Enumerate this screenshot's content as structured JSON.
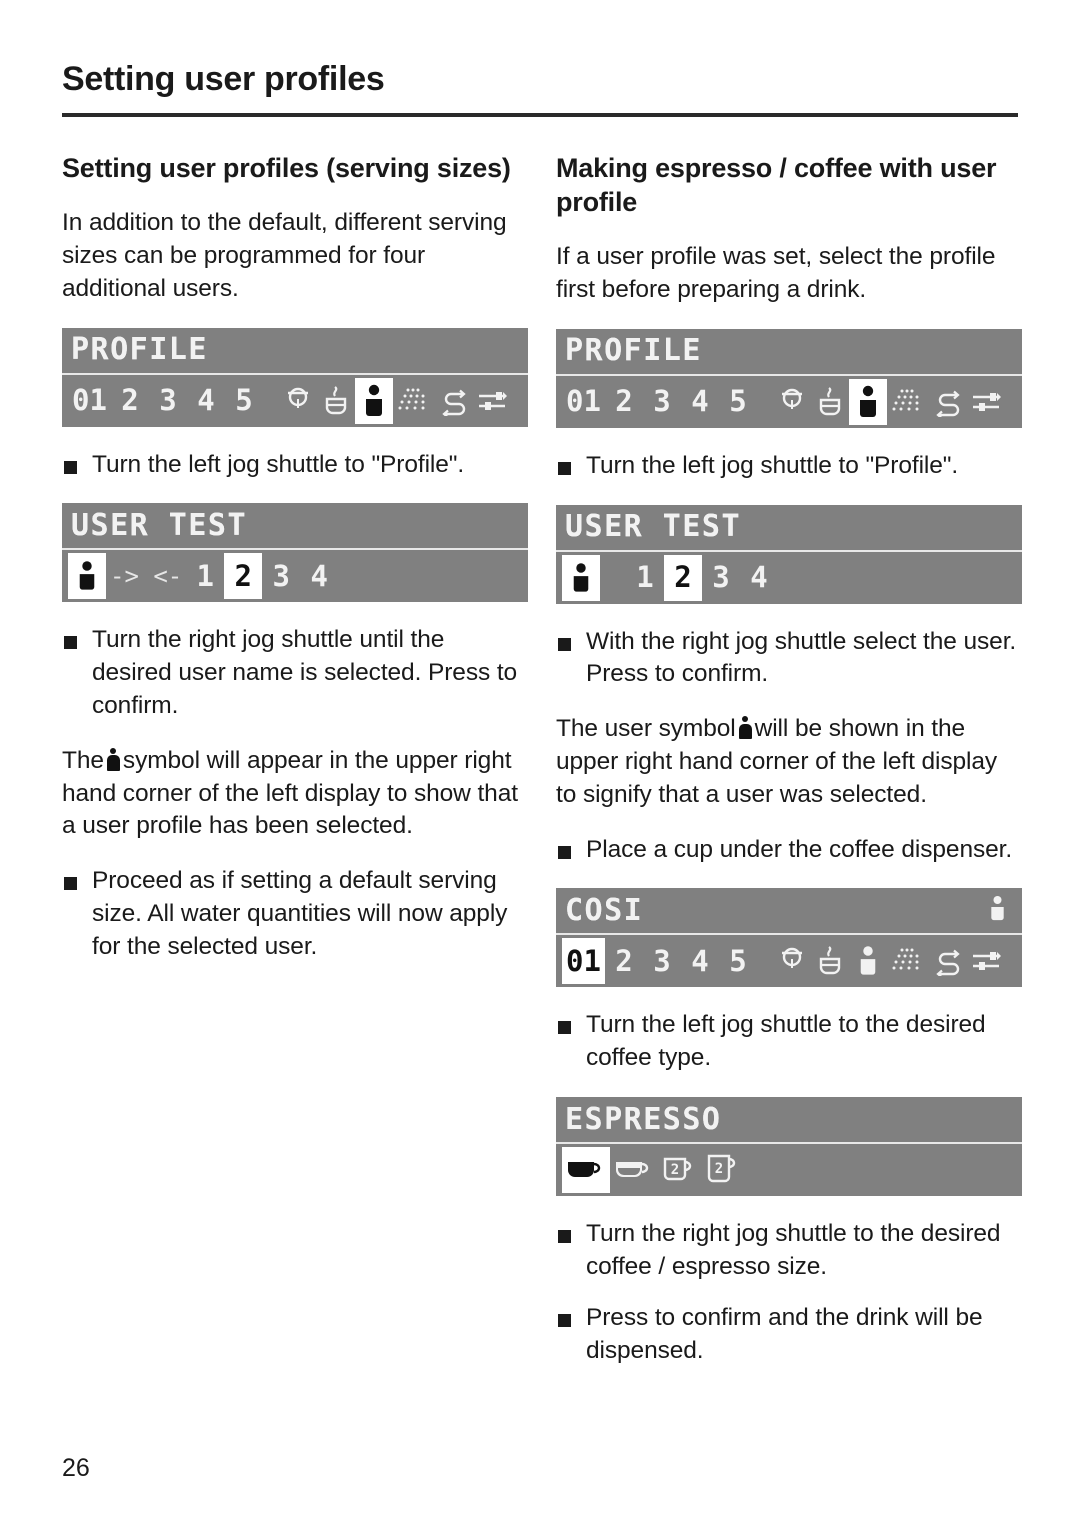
{
  "running_head": "Setting user profiles",
  "folio": "26",
  "colors": {
    "lcd_background": "#808080",
    "lcd_foreground": "#f2f2f2",
    "lcd_selected_background": "#ffffff",
    "lcd_selected_foreground": "#111111",
    "text": "#1a1a1a"
  },
  "left_column": {
    "title": "Setting user profiles (serving sizes)",
    "intro": "In addition to the default, different serving sizes can be programmed for four additional users.",
    "display_profile": {
      "title": "PROFILE",
      "items": [
        {
          "label": "01",
          "type": "number",
          "selected": false
        },
        {
          "label": "2",
          "type": "number",
          "selected": false
        },
        {
          "label": "3",
          "type": "number",
          "selected": false
        },
        {
          "label": "4",
          "type": "number",
          "selected": false
        },
        {
          "label": "5",
          "type": "number",
          "selected": false
        },
        {
          "label": "timer-icon",
          "type": "icon",
          "selected": false
        },
        {
          "label": "hot-cup-icon",
          "type": "icon",
          "selected": false
        },
        {
          "label": "person-icon",
          "type": "icon",
          "selected": true
        },
        {
          "label": "steam-icon",
          "type": "icon",
          "selected": false
        },
        {
          "label": "rinse-icon",
          "type": "icon",
          "selected": false
        },
        {
          "label": "settings-icon",
          "type": "icon",
          "selected": false
        }
      ]
    },
    "bullet_profile": "Turn the left jog shuttle to \"Profile\".",
    "display_user_test": {
      "title": "USER TEST",
      "items": [
        {
          "label": "person-icon",
          "type": "icon",
          "selected": true
        },
        {
          "label": "-> <-",
          "type": "arrows",
          "selected": false
        },
        {
          "label": "1",
          "type": "number",
          "selected": false
        },
        {
          "label": "2",
          "type": "number",
          "selected": true
        },
        {
          "label": "3",
          "type": "number",
          "selected": false
        },
        {
          "label": "4",
          "type": "number",
          "selected": false
        }
      ]
    },
    "bullet_select_user": "Turn the right jog shuttle until the desired user name is selected. Press to confirm.",
    "para_symbol_before": "The",
    "para_symbol_after": "symbol will appear in the upper right hand corner of the left display to show that a user profile has been selected.",
    "bullet_proceed": "Proceed as if setting a default serving size. All water quantities will now apply for the selected user."
  },
  "right_column": {
    "title": "Making espresso / coffee with user profile",
    "intro": "If a user profile was set, select the profile first before preparing a drink.",
    "display_profile": {
      "title": "PROFILE",
      "items": [
        {
          "label": "01",
          "type": "number",
          "selected": false
        },
        {
          "label": "2",
          "type": "number",
          "selected": false
        },
        {
          "label": "3",
          "type": "number",
          "selected": false
        },
        {
          "label": "4",
          "type": "number",
          "selected": false
        },
        {
          "label": "5",
          "type": "number",
          "selected": false
        },
        {
          "label": "timer-icon",
          "type": "icon",
          "selected": false
        },
        {
          "label": "hot-cup-icon",
          "type": "icon",
          "selected": false
        },
        {
          "label": "person-icon",
          "type": "icon",
          "selected": true
        },
        {
          "label": "steam-icon",
          "type": "icon",
          "selected": false
        },
        {
          "label": "rinse-icon",
          "type": "icon",
          "selected": false
        },
        {
          "label": "settings-icon",
          "type": "icon",
          "selected": false
        }
      ]
    },
    "bullet_profile": "Turn the left jog shuttle to \"Profile\".",
    "display_user_test": {
      "title": "USER TEST",
      "items": [
        {
          "label": "person-icon",
          "type": "icon",
          "selected": true
        },
        {
          "label": "1",
          "type": "number",
          "selected": false
        },
        {
          "label": "2",
          "type": "number",
          "selected": true
        },
        {
          "label": "3",
          "type": "number",
          "selected": false
        },
        {
          "label": "4",
          "type": "number",
          "selected": false
        }
      ]
    },
    "bullet_select_user": "With the right jog shuttle select the user. Press to confirm.",
    "para_symbol_before": "The user symbol",
    "para_symbol_after": "will be shown in the upper right hand corner of the left display to signify that a user was selected.",
    "bullet_place_cup": "Place a cup under the coffee dispenser.",
    "display_cosi": {
      "title": "COSI",
      "title_badge": "person-icon",
      "items": [
        {
          "label": "01",
          "type": "number",
          "selected": true
        },
        {
          "label": "2",
          "type": "number",
          "selected": false
        },
        {
          "label": "3",
          "type": "number",
          "selected": false
        },
        {
          "label": "4",
          "type": "number",
          "selected": false
        },
        {
          "label": "5",
          "type": "number",
          "selected": false
        },
        {
          "label": "timer-icon",
          "type": "icon",
          "selected": false
        },
        {
          "label": "hot-cup-icon",
          "type": "icon",
          "selected": false
        },
        {
          "label": "person-icon",
          "type": "icon",
          "selected": false
        },
        {
          "label": "steam-icon",
          "type": "icon",
          "selected": false
        },
        {
          "label": "rinse-icon",
          "type": "icon",
          "selected": false
        },
        {
          "label": "settings-icon",
          "type": "icon",
          "selected": false
        }
      ]
    },
    "bullet_coffee_type": "Turn the left jog shuttle to the desired coffee type.",
    "display_espresso": {
      "title": "ESPRESSO",
      "items": [
        {
          "label": "espresso-cup-filled-icon",
          "type": "icon",
          "selected": true
        },
        {
          "label": "espresso-cup-outline-icon",
          "type": "icon",
          "selected": false
        },
        {
          "label": "double-cup-small-icon",
          "type": "icon",
          "selected": false
        },
        {
          "label": "double-cup-large-icon",
          "type": "icon",
          "selected": false
        }
      ]
    },
    "bullet_size": "Turn the right jog shuttle to the desired coffee / espresso size.",
    "bullet_confirm": "Press to confirm and the drink will be dispensed."
  }
}
